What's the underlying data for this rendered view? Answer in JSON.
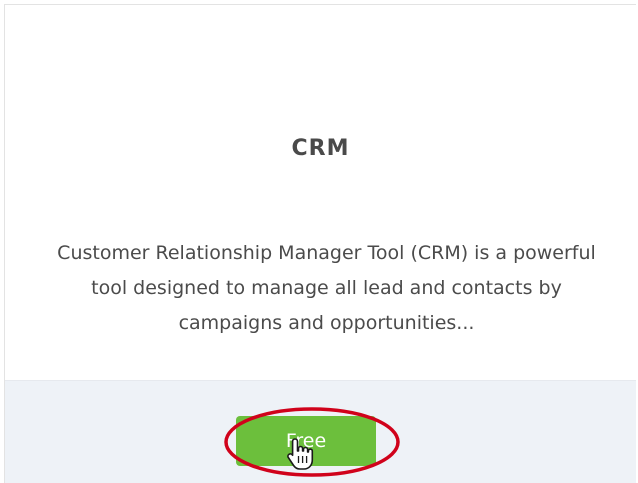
{
  "card": {
    "logo_text": "CRM",
    "description": "Customer Relationship Manager Tool (CRM) is a powerful tool designed to manage all lead and contacts by campaigns and opportunities...",
    "button_label": "Free"
  },
  "colors": {
    "button": "#6cbf3c",
    "highlight_ring": "#d0021b",
    "footer_bg": "#eef2f7"
  },
  "icons": [
    "hand-pointer-cursor-icon"
  ]
}
